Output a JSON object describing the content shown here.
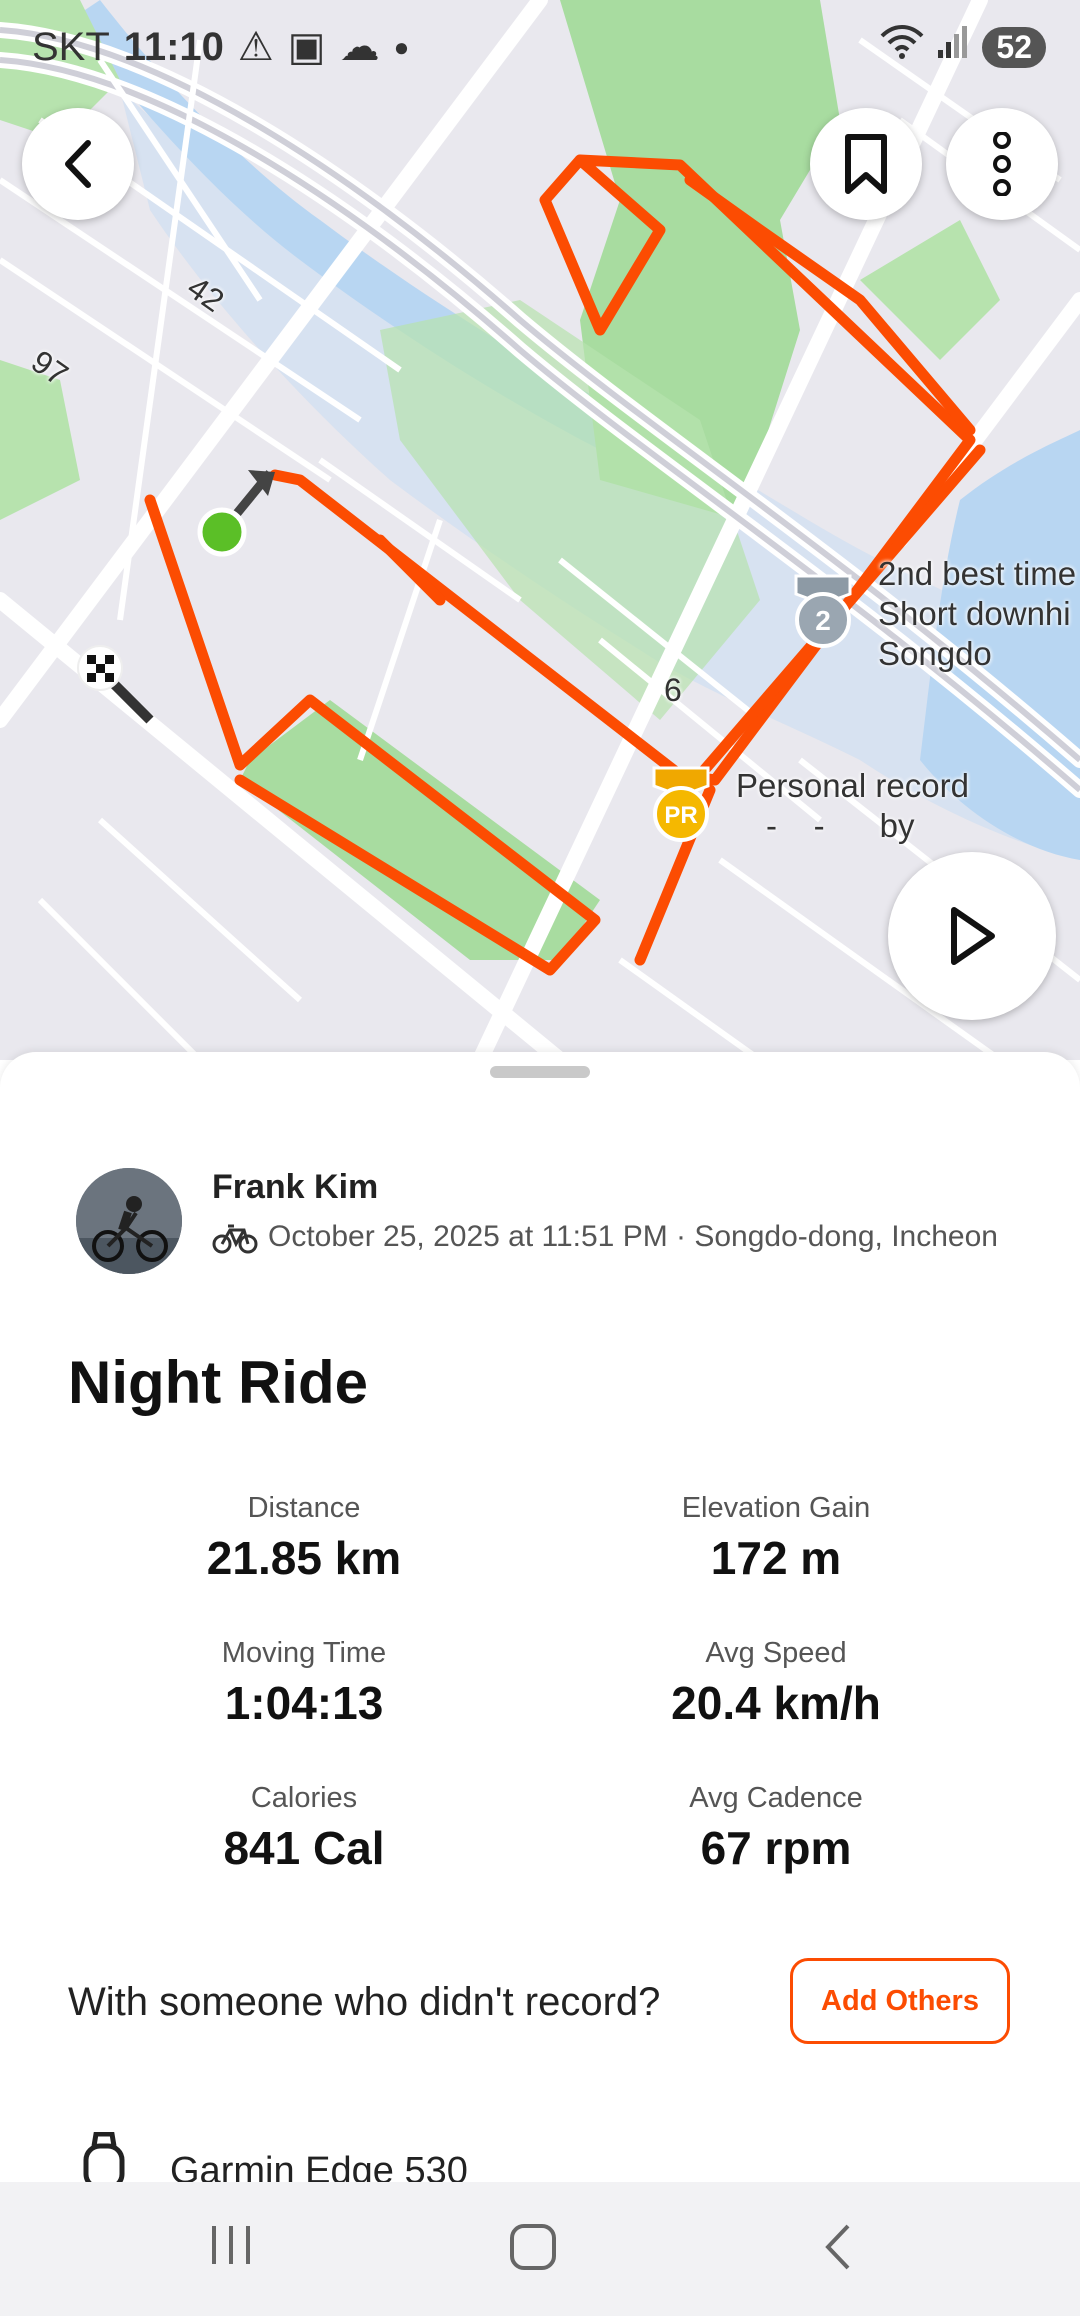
{
  "status_bar": {
    "carrier": "SKT",
    "time": "11:10",
    "battery": "52"
  },
  "map": {
    "road_labels": [
      "42",
      "97",
      "6"
    ],
    "achievements": [
      {
        "badge_text": "2",
        "line1": "2nd best time",
        "line2": "Short downhi",
        "line3": "Songdo"
      },
      {
        "badge_text": "PR",
        "line1": "Personal record",
        "line2": "-    -      by"
      }
    ],
    "route_color": "#fc4c02",
    "start_color": "#5bbf27"
  },
  "activity": {
    "athlete_name": "Frank Kim",
    "meta": "October 25, 2025 at 11:51 PM · Songdo-dong, Incheon",
    "title": "Night Ride",
    "stats": [
      {
        "label": "Distance",
        "value": "21.85 km"
      },
      {
        "label": "Elevation Gain",
        "value": "172 m"
      },
      {
        "label": "Moving Time",
        "value": "1:04:13"
      },
      {
        "label": "Avg Speed",
        "value": "20.4 km/h"
      },
      {
        "label": "Calories",
        "value": "841 Cal"
      },
      {
        "label": "Avg Cadence",
        "value": "67 rpm"
      }
    ],
    "with_others_question": "With someone who didn't record?",
    "add_others_label": "Add Others",
    "device": "Garmin Edge 530"
  },
  "icons": {
    "back": "chevron-left-icon",
    "bookmark": "bookmark-icon",
    "more": "more-vertical-icon",
    "play": "play-icon",
    "bike": "bike-icon",
    "watch": "watch-icon"
  }
}
